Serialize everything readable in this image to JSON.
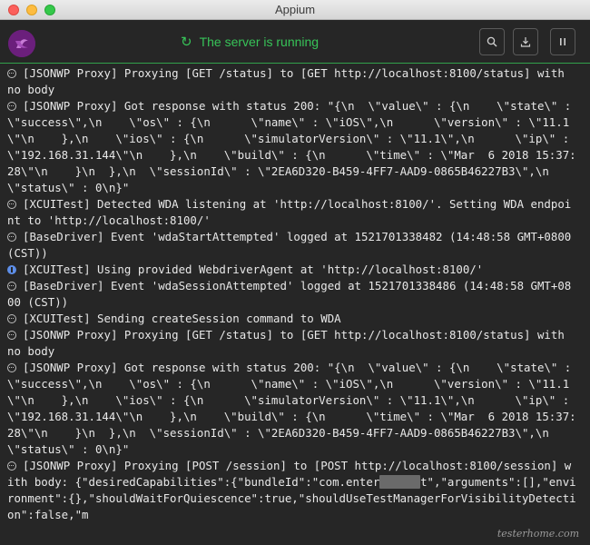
{
  "window": {
    "title": "Appium"
  },
  "toolbar": {
    "status_text": "The server is running",
    "status_icon": "refresh-icon",
    "accent_color": "#37c358",
    "search_icon": "search-icon",
    "download_icon": "download-icon",
    "pause_icon": "pause-icon"
  },
  "log": [
    {
      "icon": "debug",
      "text": "[JSONWP Proxy] Proxying [GET /status] to [GET http://localhost:8100/status] with no body"
    },
    {
      "icon": "debug",
      "text": "[JSONWP Proxy] Got response with status 200: \"{\\n  \\\"value\\\" : {\\n    \\\"state\\\" : \\\"success\\\",\\n    \\\"os\\\" : {\\n      \\\"name\\\" : \\\"iOS\\\",\\n      \\\"version\\\" : \\\"11.1\\\"\\n    },\\n    \\\"ios\\\" : {\\n      \\\"simulatorVersion\\\" : \\\"11.1\\\",\\n      \\\"ip\\\" : \\\"192.168.31.144\\\"\\n    },\\n    \\\"build\\\" : {\\n      \\\"time\\\" : \\\"Mar  6 2018 15:37:28\\\"\\n    }\\n  },\\n  \\\"sessionId\\\" : \\\"2EA6D320-B459-4FF7-AAD9-0865B46227B3\\\",\\n  \\\"status\\\" : 0\\n}\""
    },
    {
      "icon": "debug",
      "text": "[XCUITest] Detected WDA listening at 'http://localhost:8100/'. Setting WDA endpoint to 'http://localhost:8100/'"
    },
    {
      "icon": "debug",
      "text": "[BaseDriver] Event 'wdaStartAttempted' logged at 1521701338482 (14:48:58 GMT+0800 (CST))"
    },
    {
      "icon": "info",
      "text": "[XCUITest] Using provided WebdriverAgent at 'http://localhost:8100/'"
    },
    {
      "icon": "debug",
      "text": "[BaseDriver] Event 'wdaSessionAttempted' logged at 1521701338486 (14:48:58 GMT+0800 (CST))"
    },
    {
      "icon": "debug",
      "text": "[XCUITest] Sending createSession command to WDA"
    },
    {
      "icon": "debug",
      "text": "[JSONWP Proxy] Proxying [GET /status] to [GET http://localhost:8100/status] with no body"
    },
    {
      "icon": "debug",
      "text": "[JSONWP Proxy] Got response with status 200: \"{\\n  \\\"value\\\" : {\\n    \\\"state\\\" : \\\"success\\\",\\n    \\\"os\\\" : {\\n      \\\"name\\\" : \\\"iOS\\\",\\n      \\\"version\\\" : \\\"11.1\\\"\\n    },\\n    \\\"ios\\\" : {\\n      \\\"simulatorVersion\\\" : \\\"11.1\\\",\\n      \\\"ip\\\" : \\\"192.168.31.144\\\"\\n    },\\n    \\\"build\\\" : {\\n      \\\"time\\\" : \\\"Mar  6 2018 15:37:28\\\"\\n    }\\n  },\\n  \\\"sessionId\\\" : \\\"2EA6D320-B459-4FF7-AAD9-0865B46227B3\\\",\\n  \\\"status\\\" : 0\\n}\""
    },
    {
      "icon": "debug",
      "text": "[JSONWP Proxy] Proxying [POST /session] to [POST http://localhost:8100/session] with body: {\"desiredCapabilities\":{\"bundleId\":\"com.enter",
      "redacted": "xxxxxx",
      "text_after": "t\",\"arguments\":[],\"environment\":{},\"shouldWaitForQuiescence\":true,\"shouldUseTestManagerForVisibilityDetection\":false,\"m"
    }
  ],
  "watermark": "testerhome.com"
}
